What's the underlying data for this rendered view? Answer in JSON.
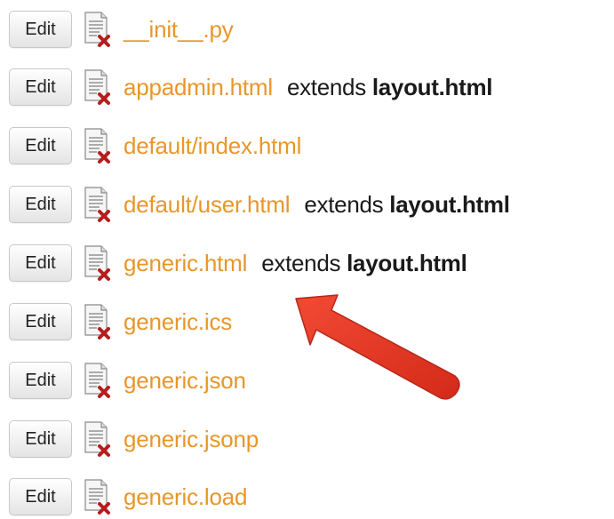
{
  "files": [
    {
      "edit_label": "Edit",
      "name": "__init__.py",
      "extends_text": "",
      "extends_target": ""
    },
    {
      "edit_label": "Edit",
      "name": "appadmin.html",
      "extends_text": "extends",
      "extends_target": "layout.html"
    },
    {
      "edit_label": "Edit",
      "name": "default/index.html",
      "extends_text": "",
      "extends_target": ""
    },
    {
      "edit_label": "Edit",
      "name": "default/user.html",
      "extends_text": "extends",
      "extends_target": "layout.html"
    },
    {
      "edit_label": "Edit",
      "name": "generic.html",
      "extends_text": "extends",
      "extends_target": "layout.html"
    },
    {
      "edit_label": "Edit",
      "name": "generic.ics",
      "extends_text": "",
      "extends_target": ""
    },
    {
      "edit_label": "Edit",
      "name": "generic.json",
      "extends_text": "",
      "extends_target": ""
    },
    {
      "edit_label": "Edit",
      "name": "generic.jsonp",
      "extends_text": "",
      "extends_target": ""
    },
    {
      "edit_label": "Edit",
      "name": "generic.load",
      "extends_text": "",
      "extends_target": ""
    }
  ],
  "colors": {
    "link": "#e8962a",
    "arrow": "#e0301e",
    "delete_icon": "#b81c1c"
  },
  "icons": {
    "file": "document-delete-icon",
    "annotation": "red-arrow-annotation"
  }
}
